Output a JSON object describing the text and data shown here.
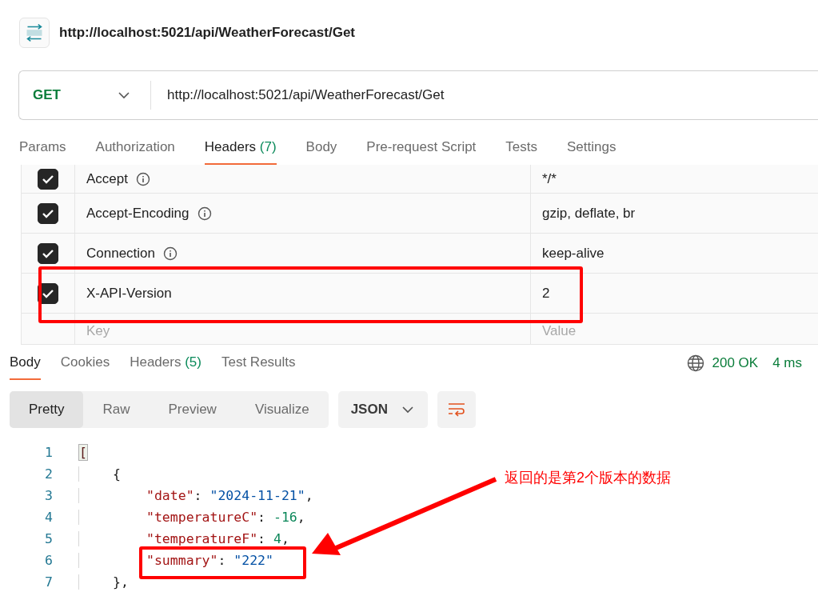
{
  "request": {
    "title": "http://localhost:5021/api/WeatherForecast/Get",
    "method": "GET",
    "url": "http://localhost:5021/api/WeatherForecast/Get"
  },
  "request_tabs": [
    {
      "label": "Params",
      "selected": false
    },
    {
      "label": "Authorization",
      "selected": false
    },
    {
      "label": "Headers",
      "count": "(7)",
      "selected": true
    },
    {
      "label": "Body",
      "selected": false
    },
    {
      "label": "Pre-request Script",
      "selected": false
    },
    {
      "label": "Tests",
      "selected": false
    },
    {
      "label": "Settings",
      "selected": false
    }
  ],
  "headers": [
    {
      "key": "Accept",
      "value": "*/*",
      "checked": true,
      "info": true
    },
    {
      "key": "Accept-Encoding",
      "value": "gzip, deflate, br",
      "checked": true,
      "info": true
    },
    {
      "key": "Connection",
      "value": "keep-alive",
      "checked": true,
      "info": true
    },
    {
      "key": "X-API-Version",
      "value": "2",
      "checked": true,
      "info": false
    }
  ],
  "new_header": {
    "key_placeholder": "Key",
    "value_placeholder": "Value"
  },
  "response_tabs": [
    {
      "label": "Body",
      "selected": true
    },
    {
      "label": "Cookies",
      "selected": false
    },
    {
      "label": "Headers",
      "count": "(5)",
      "selected": false
    },
    {
      "label": "Test Results",
      "selected": false
    }
  ],
  "status": {
    "code": "200 OK",
    "time": "4 ms"
  },
  "view_modes": [
    {
      "label": "Pretty",
      "selected": true
    },
    {
      "label": "Raw",
      "selected": false
    },
    {
      "label": "Preview",
      "selected": false
    },
    {
      "label": "Visualize",
      "selected": false
    }
  ],
  "format": "JSON",
  "code_lines": [
    {
      "number": "1",
      "tokens": [
        {
          "kind": "match",
          "text": "["
        }
      ],
      "children": [
        {
          "number": "2",
          "tokens": [
            {
              "kind": "punct",
              "text": "{"
            }
          ],
          "children": [
            {
              "number": "3",
              "tokens": [
                {
                  "kind": "key",
                  "text": "\"date\""
                },
                {
                  "kind": "punct",
                  "text": ": "
                },
                {
                  "kind": "string",
                  "text": "\"2024-11-21\""
                },
                {
                  "kind": "punct",
                  "text": ","
                }
              ]
            },
            {
              "number": "4",
              "tokens": [
                {
                  "kind": "key",
                  "text": "\"temperatureC\""
                },
                {
                  "kind": "punct",
                  "text": ": "
                },
                {
                  "kind": "number",
                  "text": "-16"
                },
                {
                  "kind": "punct",
                  "text": ","
                }
              ]
            },
            {
              "number": "5",
              "tokens": [
                {
                  "kind": "key",
                  "text": "\"temperatureF\""
                },
                {
                  "kind": "punct",
                  "text": ": "
                },
                {
                  "kind": "number",
                  "text": "4"
                },
                {
                  "kind": "punct",
                  "text": ","
                }
              ]
            },
            {
              "number": "6",
              "tokens": [
                {
                  "kind": "key",
                  "text": "\"summary\""
                },
                {
                  "kind": "punct",
                  "text": ": "
                },
                {
                  "kind": "string",
                  "text": "\"222\""
                }
              ]
            }
          ]
        },
        {
          "number": "7",
          "tokens": [
            {
              "kind": "punct",
              "text": "},"
            }
          ]
        }
      ]
    }
  ],
  "annotation": {
    "text": "返回的是第2个版本的数据"
  }
}
